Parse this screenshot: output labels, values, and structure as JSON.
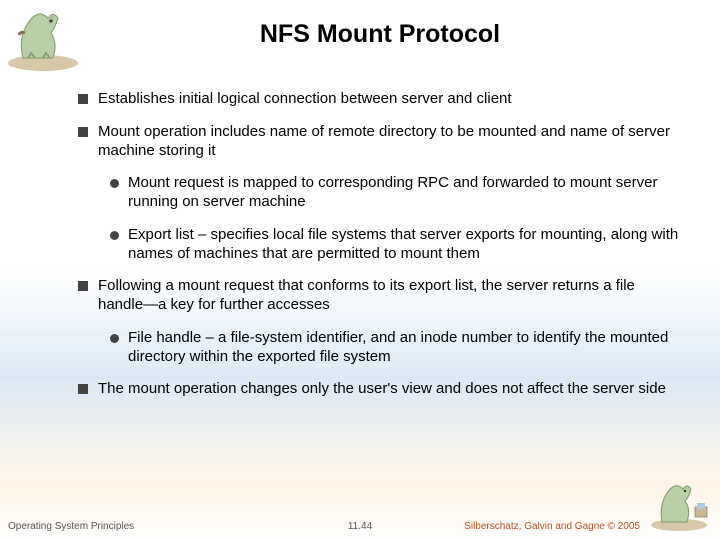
{
  "title": "NFS Mount Protocol",
  "bullets": {
    "b1": "Establishes initial logical connection between server and client",
    "b2": "Mount operation includes name of remote directory to be mounted and name of server machine storing it",
    "b2a": "Mount request is mapped to corresponding RPC and forwarded to mount server running on server machine",
    "b2b": "Export list – specifies local file systems that server exports for mounting, along with names of machines that are permitted to mount them",
    "b3": "Following a mount request that conforms to its export list, the server returns a file handle—a key for further accesses",
    "b3a": "File handle – a file-system identifier, and an inode number to identify the mounted directory within the exported file system",
    "b4": "The mount operation changes only the user's view and does not affect the server side"
  },
  "footer": {
    "left": "Operating System Principles",
    "center": "11.44",
    "right": "Silberschatz, Galvin and Gagne © 2005"
  },
  "colors": {
    "dino_body": "#b8cfa8",
    "dino_accent": "#8a6d5a",
    "ground": "#d9c8a8"
  }
}
